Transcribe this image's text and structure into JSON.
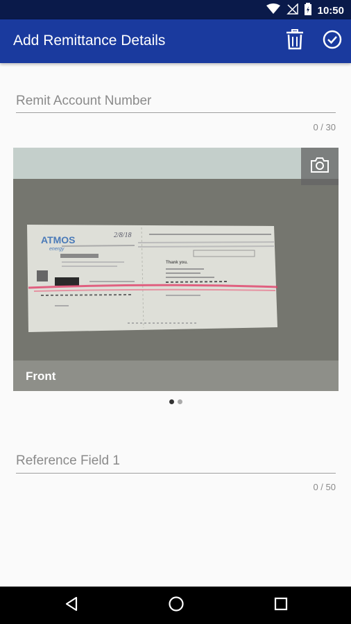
{
  "status_bar": {
    "time": "10:50"
  },
  "app_bar": {
    "title": "Add Remittance Details",
    "icons": {
      "delete": "trash-icon",
      "confirm": "check-circle-icon"
    }
  },
  "remit_account": {
    "label": "Remit Account Number",
    "value": "",
    "counter": "0 / 30"
  },
  "photo": {
    "caption": "Front",
    "camera_icon": "camera-icon",
    "stub": {
      "company": "ATMOS",
      "company_sub": "energy",
      "handwritten": "2/8/18",
      "thank_you": "Thank you."
    },
    "page_indicator": {
      "total": 2,
      "active": 1
    }
  },
  "reference_field": {
    "label": "Reference Field 1",
    "value": "",
    "counter": "0 / 50"
  },
  "colors": {
    "app_bar": "#1a3a9e",
    "status_bar": "#0a1a4a",
    "accent_dot": "#333333"
  }
}
